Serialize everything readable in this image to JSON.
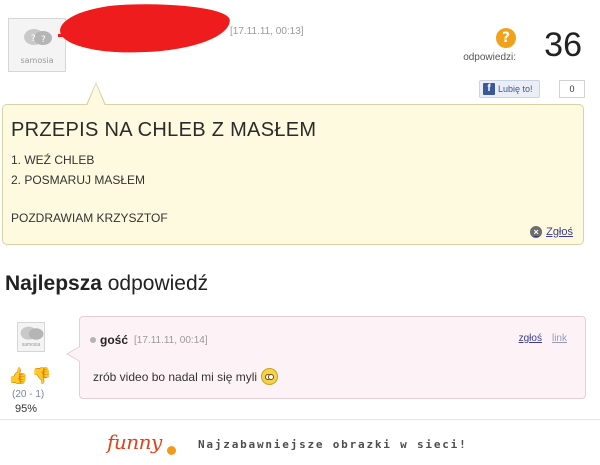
{
  "question": {
    "date": "[17.11.11, 00:13]",
    "avatar_label": "samosia",
    "answers_label": "odpowiedzi:",
    "answers_count": "36",
    "answers_icon": "?",
    "like_label": "Lubię to!",
    "like_count": "0",
    "title": "PRZEPIS NA CHLEB Z MASŁEM",
    "lines": [
      "1. WEŹ CHLEB",
      "2. POSMARUJ MASŁEM",
      "POZDRAWIAM KRZYSZTOF"
    ],
    "report_label": "Zgłoś"
  },
  "best_answer": {
    "heading_bold": "Najlepsza",
    "heading_rest": "odpowiedź",
    "avatar_label": "samosia",
    "author": "gość",
    "date": "[17.11.11, 00:14]",
    "report_label": "zgłoś",
    "link_label": "link",
    "text": "zrób video bo nadal mi się myli",
    "votes": "(20 - 1)",
    "percent": "95%"
  },
  "footer": {
    "logo": "funny",
    "tagline": "Najzabawniejsze obrazki w sieci!"
  },
  "colors": {
    "question_bg": "#fefadf",
    "answer_bg": "#fdf3f7",
    "redaction": "#ee1c1c",
    "accent_orange": "#f2a21a",
    "facebook": "#3b5998"
  }
}
